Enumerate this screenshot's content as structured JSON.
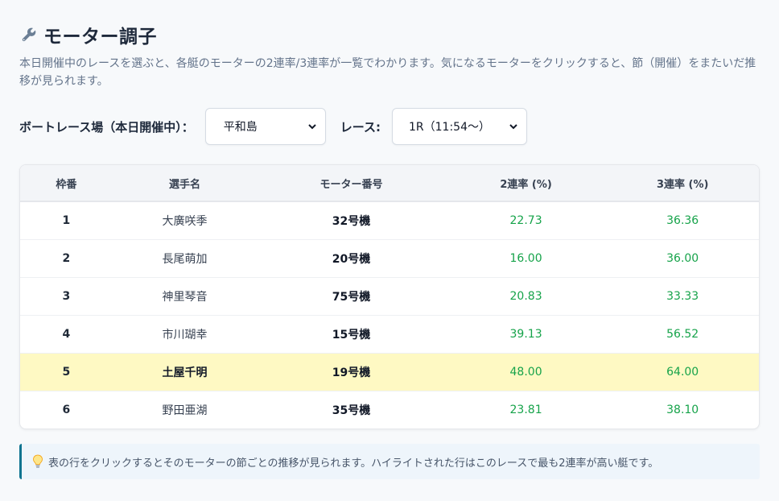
{
  "header": {
    "title": "モーター調子",
    "icon": "wrench-icon",
    "description": "本日開催中のレースを選ぶと、各艇のモーターの2連率/3連率が一覧でわかります。気になるモーターをクリックすると、節（開催）をまたいだ推移が見られます。"
  },
  "controls": {
    "venue_label": "ボートレース場（本日開催中）：",
    "venue_value": "平和島",
    "race_label": "レース:",
    "race_value": "1R（11:54〜）"
  },
  "table": {
    "columns": [
      "枠番",
      "選手名",
      "モーター番号",
      "2連率 (%)",
      "3連率 (%)"
    ],
    "rows": [
      {
        "frame": "1",
        "name": "大廣咲季",
        "motor": "32号機",
        "rate2": "22.73",
        "rate3": "36.36",
        "highlight": false
      },
      {
        "frame": "2",
        "name": "長尾萌加",
        "motor": "20号機",
        "rate2": "16.00",
        "rate3": "36.00",
        "highlight": false
      },
      {
        "frame": "3",
        "name": "神里琴音",
        "motor": "75号機",
        "rate2": "20.83",
        "rate3": "33.33",
        "highlight": false
      },
      {
        "frame": "4",
        "name": "市川瑚幸",
        "motor": "15号機",
        "rate2": "39.13",
        "rate3": "56.52",
        "highlight": false
      },
      {
        "frame": "5",
        "name": "土屋千明",
        "motor": "19号機",
        "rate2": "48.00",
        "rate3": "64.00",
        "highlight": true
      },
      {
        "frame": "6",
        "name": "野田亜湖",
        "motor": "35号機",
        "rate2": "23.81",
        "rate3": "38.10",
        "highlight": false
      }
    ]
  },
  "note": {
    "icon": "lightbulb-icon",
    "text": "表の行をクリックするとそのモーターの節ごとの推移が見られます。ハイライトされた行はこのレースで最も2連率が高い艇です。"
  },
  "colors": {
    "rate_green": "#16a34a",
    "highlight_row": "#fef9c3",
    "note_border": "#0e7490"
  }
}
